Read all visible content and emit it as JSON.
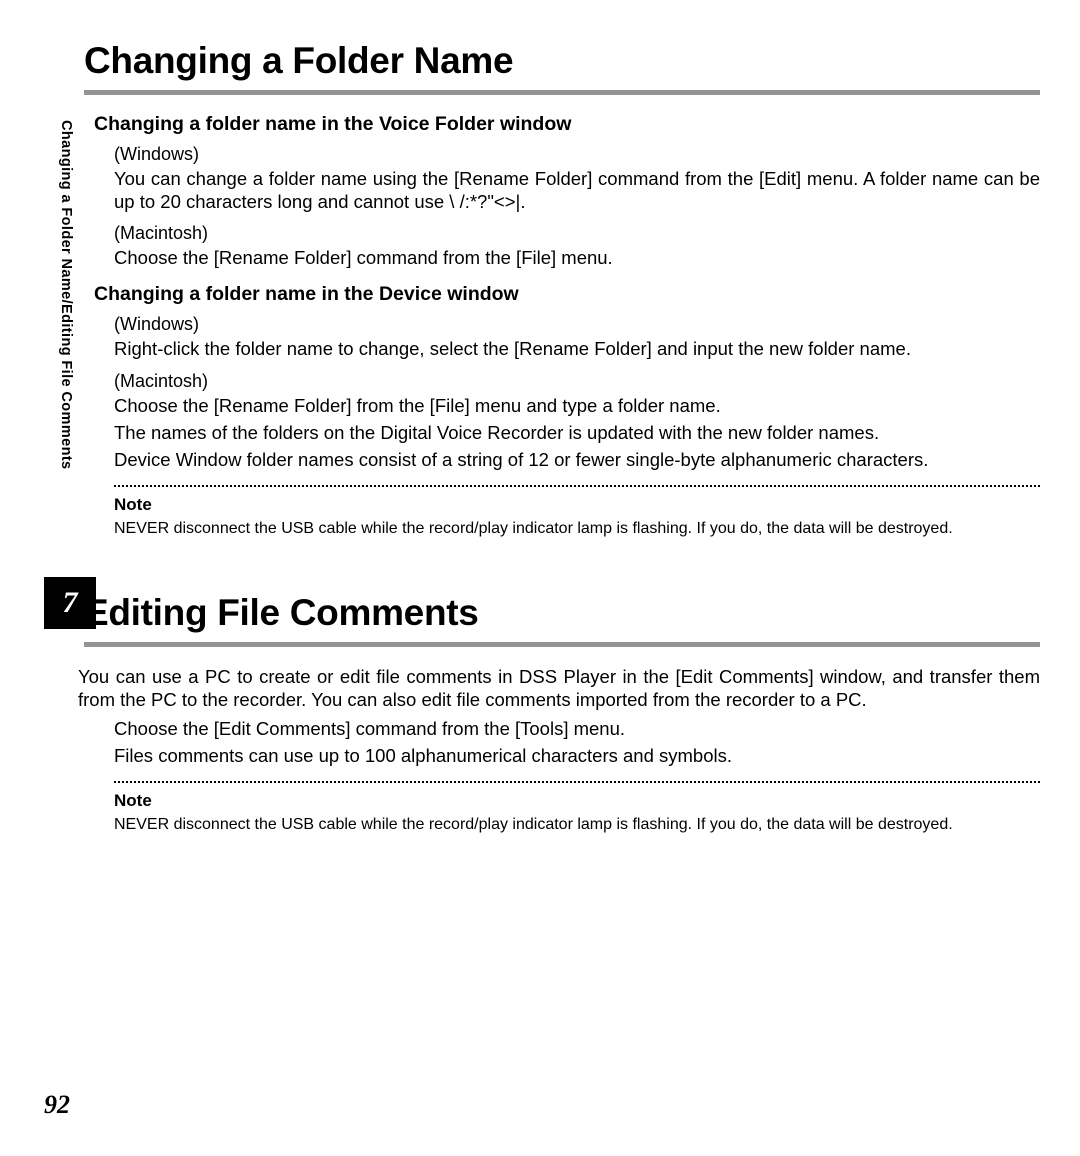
{
  "sideTab": "Changing a Folder Name/Editing File Comments",
  "chapterNumber": "7",
  "pageNumber": "92",
  "section1": {
    "title": "Changing a Folder Name",
    "sub1": {
      "heading": "Changing a folder name in the Voice Folder window",
      "winLabel": "(Windows)",
      "winText": "You can change a folder name using the [Rename Folder] command from the [Edit] menu. A folder name can be up to 20 characters long and cannot use \\ /:*?\"<>|.",
      "macLabel": "(Macintosh)",
      "macText": "Choose the [Rename Folder] command from the [File] menu."
    },
    "sub2": {
      "heading": "Changing a folder name in the Device window",
      "winLabel": "(Windows)",
      "winText": "Right-click the folder name to change, select the [Rename Folder] and input the new folder name.",
      "macLabel": "(Macintosh)",
      "macText1": "Choose the [Rename Folder] from the [File] menu and type a folder name.",
      "macText2": "The names of the folders on the Digital Voice Recorder is updated with the new folder names.",
      "macText3": "Device Window folder names consist of a string of 12 or fewer single-byte alphanumeric characters."
    },
    "noteLabel": "Note",
    "noteText": "NEVER disconnect the USB cable while the record/play indicator lamp is flashing. If you do, the data will be destroyed."
  },
  "section2": {
    "title": "Editing File Comments",
    "intro": "You can use a PC to create or edit file comments in DSS Player in the [Edit Comments] window, and transfer them from the PC to the recorder. You can also edit file comments imported from the recorder to a PC.",
    "line1": "Choose the [Edit Comments] command from the [Tools] menu.",
    "line2": "Files comments can use up to 100 alphanumerical characters and symbols.",
    "noteLabel": "Note",
    "noteText": "NEVER disconnect the USB cable while the record/play indicator lamp is flashing. If you do, the data will be destroyed."
  }
}
